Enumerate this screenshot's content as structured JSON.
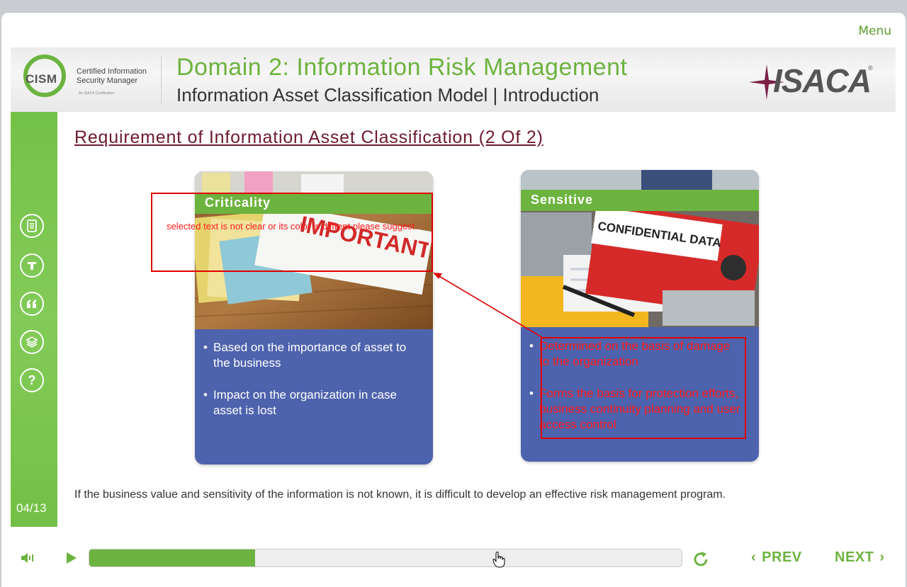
{
  "menu": {
    "label": "Menu"
  },
  "header": {
    "cism_logo": {
      "mark": "CISM",
      "line1": "Certified Information",
      "line2": "Security Manager",
      "tagline": "An ISACA Certification"
    },
    "domain_title": "Domain 2: Information Risk Management",
    "subtitle": "Information Asset Classification Model | Introduction",
    "isaca_logo": {
      "text": "ISACA",
      "reg": "®"
    }
  },
  "left_rail": {
    "icons": [
      "notes-icon",
      "transcript-icon",
      "quote-icon",
      "layers-icon",
      "help-icon"
    ],
    "page_count": "04/13"
  },
  "slide": {
    "title": "Requirement of Information Asset Classification (2 Of 2)",
    "cards": [
      {
        "heading": "Criticality",
        "photo": "important-tag-photo",
        "bullets": [
          "Based on the importance of asset to the business",
          "Impact on the organization in case asset is lost"
        ]
      },
      {
        "heading": "Sensitive",
        "photo": "confidential-data-folder-photo",
        "bullets": [
          "Determined on the basis of damage to the organization",
          "Forms the basis for protection efforts, business continuity planning and user access control"
        ]
      }
    ],
    "footnote": "If the business value and sensitivity of the information is not known, it is difficult to develop an effective risk management program."
  },
  "annotation": {
    "note": "selected text is not clear or its color is diffrent please suggest.",
    "color": "#e00000"
  },
  "controls": {
    "progress_fraction": 0.28,
    "prev_label": "PREV",
    "next_label": "NEXT"
  },
  "colors": {
    "accent_green": "#6db33f",
    "card_blue": "#4e63ad",
    "title_maroon": "#6d1a2e"
  }
}
